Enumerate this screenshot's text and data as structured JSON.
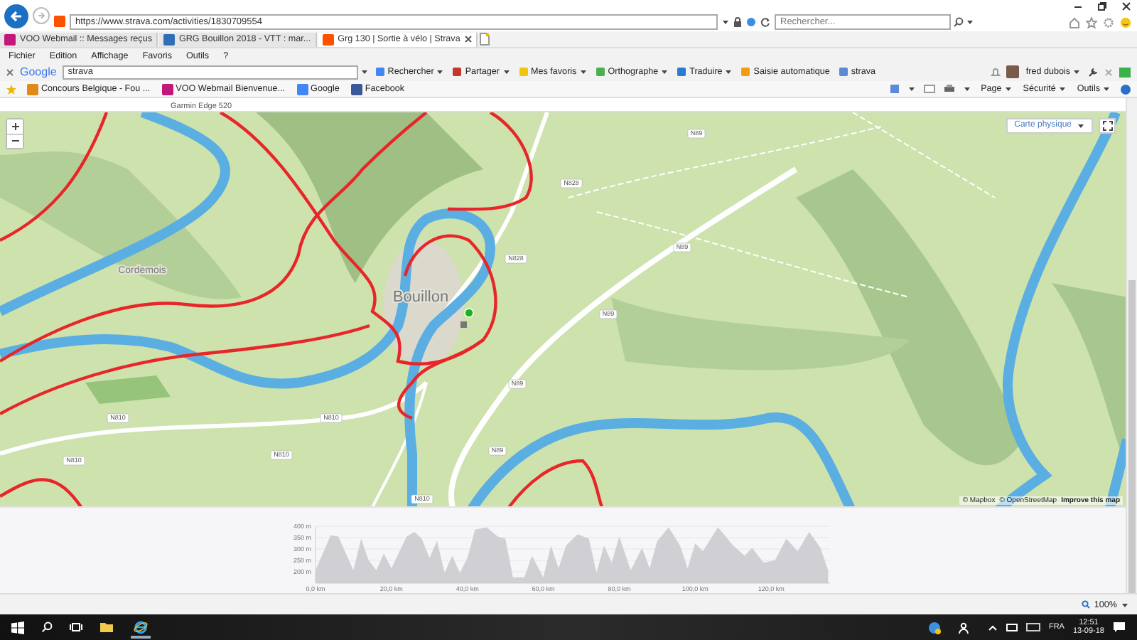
{
  "browser": {
    "address": "https://www.strava.com/activities/1830709554",
    "search_placeholder": "Rechercher...",
    "tabs": [
      {
        "label": "VOO Webmail :: Messages reçus",
        "selected": false
      },
      {
        "label": "GRG Bouillon 2018 - VTT : mar...",
        "selected": false
      },
      {
        "label": "Grg 130 | Sortie à vélo | Strava",
        "selected": true
      }
    ],
    "menu": [
      "Fichier",
      "Edition",
      "Affichage",
      "Favoris",
      "Outils",
      "?"
    ],
    "google_toolbar": {
      "brand": "Google",
      "query": "strava",
      "buttons": [
        "Rechercher",
        "Partager",
        "Mes favoris",
        "Orthographe",
        "Traduire",
        "Saisie automatique",
        "strava"
      ],
      "user": "fred dubois"
    },
    "favorites": [
      "Concours Belgique - Fou ...",
      "VOO Webmail  Bienvenue...",
      "Google",
      "Facebook"
    ],
    "command_bar": [
      "Page",
      "Sécurité",
      "Outils"
    ],
    "zoom": "100%"
  },
  "page": {
    "device": "Garmin Edge 520",
    "map": {
      "style_button": "Carte physique",
      "places": [
        "Cordemois",
        "Bouillon"
      ],
      "roads": [
        "N810",
        "N810",
        "N810",
        "N810",
        "N810",
        "N828",
        "N828",
        "N89",
        "N89",
        "N89",
        "N89",
        "N89"
      ],
      "attribution": [
        "© Mapbox",
        "© OpenStreetMap",
        "Improve this map"
      ]
    },
    "elevation": {
      "chart_data": {
        "type": "area",
        "grid": true,
        "xlim": [
          0,
          135.5
        ],
        "ylim": [
          150,
          400
        ],
        "xticks": [
          {
            "value": 0,
            "label": "0,0 km"
          },
          {
            "value": 20,
            "label": "20,0 km"
          },
          {
            "value": 40,
            "label": "40,0 km"
          },
          {
            "value": 60,
            "label": "60,0 km"
          },
          {
            "value": 80,
            "label": "80,0 km"
          },
          {
            "value": 100,
            "label": "100,0 km"
          },
          {
            "value": 120,
            "label": "120,0 km"
          }
        ],
        "yticks": [
          {
            "value": 200,
            "label": "200 m"
          },
          {
            "value": 250,
            "label": "250 m"
          },
          {
            "value": 300,
            "label": "300 m"
          },
          {
            "value": 350,
            "label": "350 m"
          },
          {
            "value": 400,
            "label": "400 m"
          }
        ],
        "x": [
          0,
          4,
          6,
          8,
          10,
          12,
          14,
          16,
          18,
          20,
          24,
          26,
          28,
          30,
          32,
          34,
          36,
          38,
          40,
          42,
          45,
          48,
          50,
          52,
          55,
          57,
          60,
          62,
          64,
          66,
          69,
          72,
          74,
          76,
          78,
          80,
          83,
          86,
          88,
          90,
          93,
          96,
          98,
          100,
          102,
          106,
          110,
          113,
          115,
          118,
          121,
          124,
          127,
          130,
          133,
          135
        ],
        "series": [
          {
            "color": "#cfcfd4",
            "values": [
              206,
              360,
              355,
              280,
              206,
              345,
              250,
              206,
              280,
              215,
              355,
              375,
              345,
              260,
              335,
              195,
              270,
              195,
              260,
              385,
              395,
              355,
              345,
              175,
              175,
              270,
              175,
              315,
              215,
              315,
              365,
              345,
              195,
              315,
              240,
              355,
              206,
              305,
              215,
              335,
              395,
              315,
              215,
              325,
              290,
              395,
              315,
              270,
              305,
              240,
              250,
              345,
              290,
              375,
              305,
              206
            ]
          }
        ]
      }
    }
  },
  "taskbar": {
    "language": "FRA",
    "time": "12:51",
    "date": "13-09-18"
  }
}
